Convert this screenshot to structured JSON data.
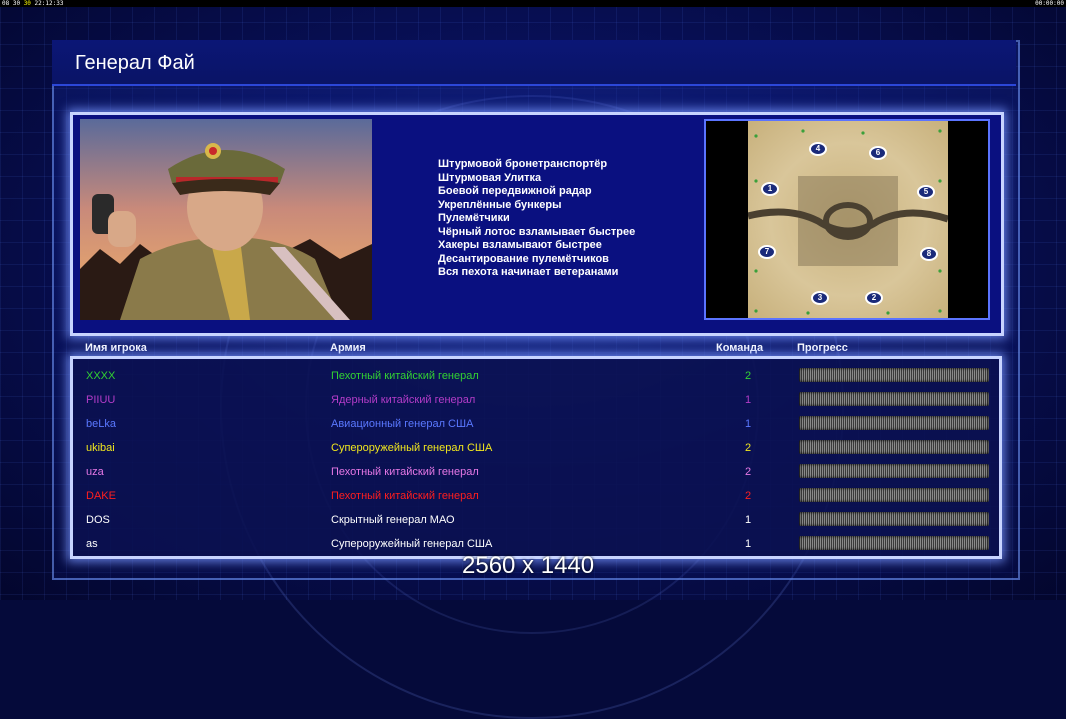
{
  "hud": {
    "left_a": "08 30",
    "left_b": "30",
    "left_c": "22:12:33",
    "right": "00:00:00"
  },
  "title": "Генерал Фай",
  "traits": [
    "Штурмовой бронетранспортёр",
    "Штурмовая Улитка",
    "Боевой передвижной радар",
    "Укреплённые бункеры",
    "Пулемётчики",
    "Чёрный лотос взламывает быстрее",
    "Хакеры взламывают быстрее",
    "Десантирование пулемётчиков",
    "Вся пехота начинает ветеранами"
  ],
  "map": {
    "spawns": [
      "1",
      "2",
      "3",
      "4",
      "5",
      "6",
      "7",
      "8"
    ]
  },
  "columns": {
    "name": "Имя игрока",
    "army": "Армия",
    "team": "Команда",
    "progress": "Прогресс"
  },
  "players": [
    {
      "name": "XXXX",
      "army": "Пехотный китайский генерал",
      "team": "2",
      "color": "#32d232"
    },
    {
      "name": "PIIUU",
      "army": "Ядерный китайский генерал",
      "team": "1",
      "color": "#b43cc8"
    },
    {
      "name": "beLka",
      "army": "Авиационный генерал США",
      "team": "1",
      "color": "#5a78ff"
    },
    {
      "name": "ukibai",
      "army": "Супероружейный генерал США",
      "team": "2",
      "color": "#f0e61e"
    },
    {
      "name": "uza",
      "army": "Пехотный китайский генерал",
      "team": "2",
      "color": "#e678e6"
    },
    {
      "name": "DAKE",
      "army": "Пехотный китайский генерал",
      "team": "2",
      "color": "#ff1e1e"
    },
    {
      "name": "DOS",
      "army": "Скрытный генерал МАО",
      "team": "1",
      "color": "#ffffff"
    },
    {
      "name": "as",
      "army": "Супероружейный генерал США",
      "team": "1",
      "color": "#ffffff"
    }
  ],
  "resolution": "2560 x 1440"
}
